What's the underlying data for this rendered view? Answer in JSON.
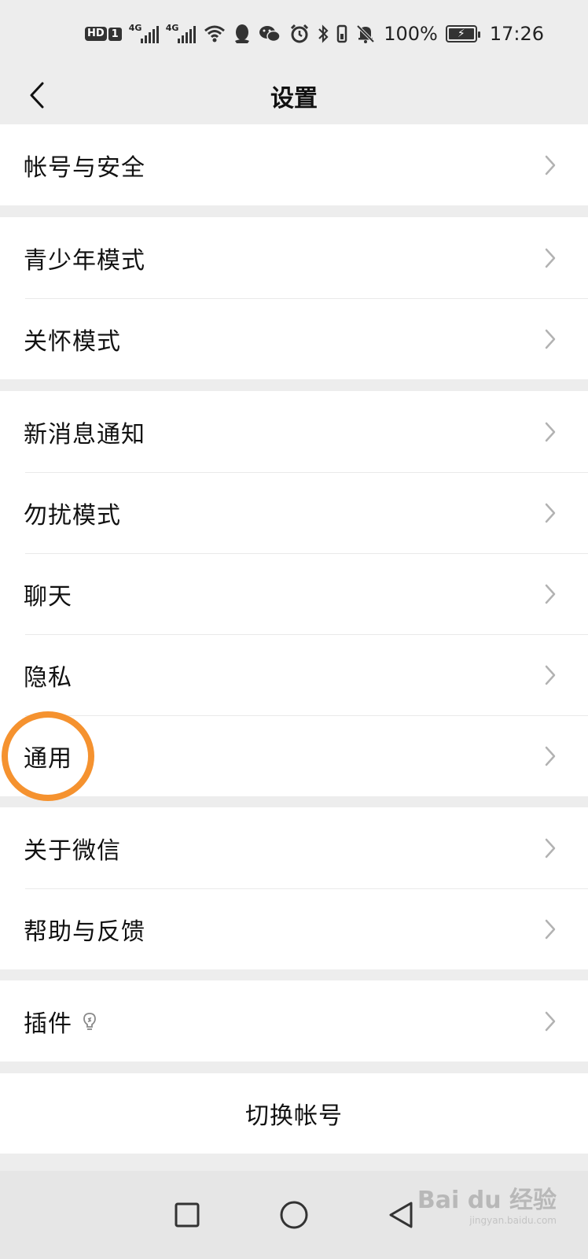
{
  "status_bar": {
    "hd": "HD",
    "sim": "1",
    "net1": "4G",
    "net2": "4G",
    "battery_pct": "100%",
    "time": "17:26",
    "icons": [
      "signal-icon",
      "wifi-icon",
      "qq-icon",
      "wechat-icon",
      "alarm-icon",
      "bluetooth-icon",
      "vibrate-icon",
      "mute-icon",
      "battery-icon"
    ]
  },
  "nav": {
    "title": "设置"
  },
  "groups": [
    {
      "items": [
        {
          "label": "帐号与安全"
        }
      ]
    },
    {
      "items": [
        {
          "label": "青少年模式"
        },
        {
          "label": "关怀模式"
        }
      ]
    },
    {
      "items": [
        {
          "label": "新消息通知"
        },
        {
          "label": "勿扰模式"
        },
        {
          "label": "聊天"
        },
        {
          "label": "隐私"
        },
        {
          "label": "通用"
        }
      ]
    },
    {
      "items": [
        {
          "label": "关于微信"
        },
        {
          "label": "帮助与反馈"
        }
      ]
    },
    {
      "items": [
        {
          "label": "插件"
        }
      ]
    }
  ],
  "switch_account": "切换帐号",
  "highlight": {
    "target": "通用",
    "color": "#f5922f"
  },
  "watermark": {
    "brand": "Bai du 经验",
    "url": "jingyan.baidu.com"
  }
}
